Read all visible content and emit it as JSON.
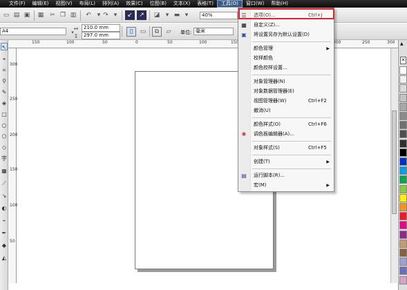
{
  "menubar": {
    "items": [
      "文件(F)",
      "编辑(E)",
      "视图(V)",
      "布局(L)",
      "排列(A)",
      "效果(C)",
      "位图(B)",
      "文本(X)",
      "表格(T)",
      "工具(O)",
      "窗口(W)",
      "帮助(H)"
    ],
    "active": "工具(O)"
  },
  "toolbar": {
    "zoom": "40%"
  },
  "propbar": {
    "page_size": "A4",
    "width": "210.0 mm",
    "height": "297.0 mm",
    "units_label": "单位:",
    "units_value": "毫米"
  },
  "ruler": {
    "h": [
      "150",
      "100",
      "50",
      "0",
      "50",
      "100",
      "150",
      "200",
      "250",
      "300"
    ],
    "v": [
      "300",
      "250",
      "200",
      "150",
      "100",
      "50"
    ]
  },
  "tools_menu": {
    "options": {
      "label": "选项(O)...",
      "shortcut": "Ctrl+J"
    },
    "customize": {
      "label": "自定义(Z)..."
    },
    "save_default": {
      "label": "将设置另存为默认设置(D)"
    },
    "color_management": {
      "label": "颜色管理"
    },
    "proof_colors": {
      "label": "校样颜色"
    },
    "proof_settings": {
      "label": "颜色校样设置..."
    },
    "object_manager": {
      "label": "对象管理器(N)"
    },
    "object_data": {
      "label": "对象数据管理器(E)"
    },
    "view_manager": {
      "label": "视图管理器(W)",
      "shortcut": "Ctrl+F2"
    },
    "undo": {
      "label": "撤消(U)"
    },
    "color_styles": {
      "label": "颜色样式(O)",
      "shortcut": "Ctrl+F6"
    },
    "palette_editor": {
      "label": "调色板编辑器(A)..."
    },
    "object_styles": {
      "label": "对象样式(S)",
      "shortcut": "Ctrl+F5"
    },
    "create": {
      "label": "创建(T)"
    },
    "run_script": {
      "label": "运行脚本(R)..."
    },
    "macros": {
      "label": "宏(M)"
    }
  },
  "palette_colors": [
    "#ffffff",
    "#f0f0f0",
    "#dcdcdc",
    "#c4c4c4",
    "#a8a8a8",
    "#8c8c8c",
    "#707070",
    "#505050",
    "#303030",
    "#000000",
    "#0033cc",
    "#00a0e9",
    "#00a651",
    "#8dc63f",
    "#fff200",
    "#f7941d",
    "#ed1c24",
    "#ec008c",
    "#92278f",
    "#c69c6d",
    "#8b5e3c",
    "#a0a0d0",
    "#6d6dbf",
    "#d9a0c8"
  ]
}
